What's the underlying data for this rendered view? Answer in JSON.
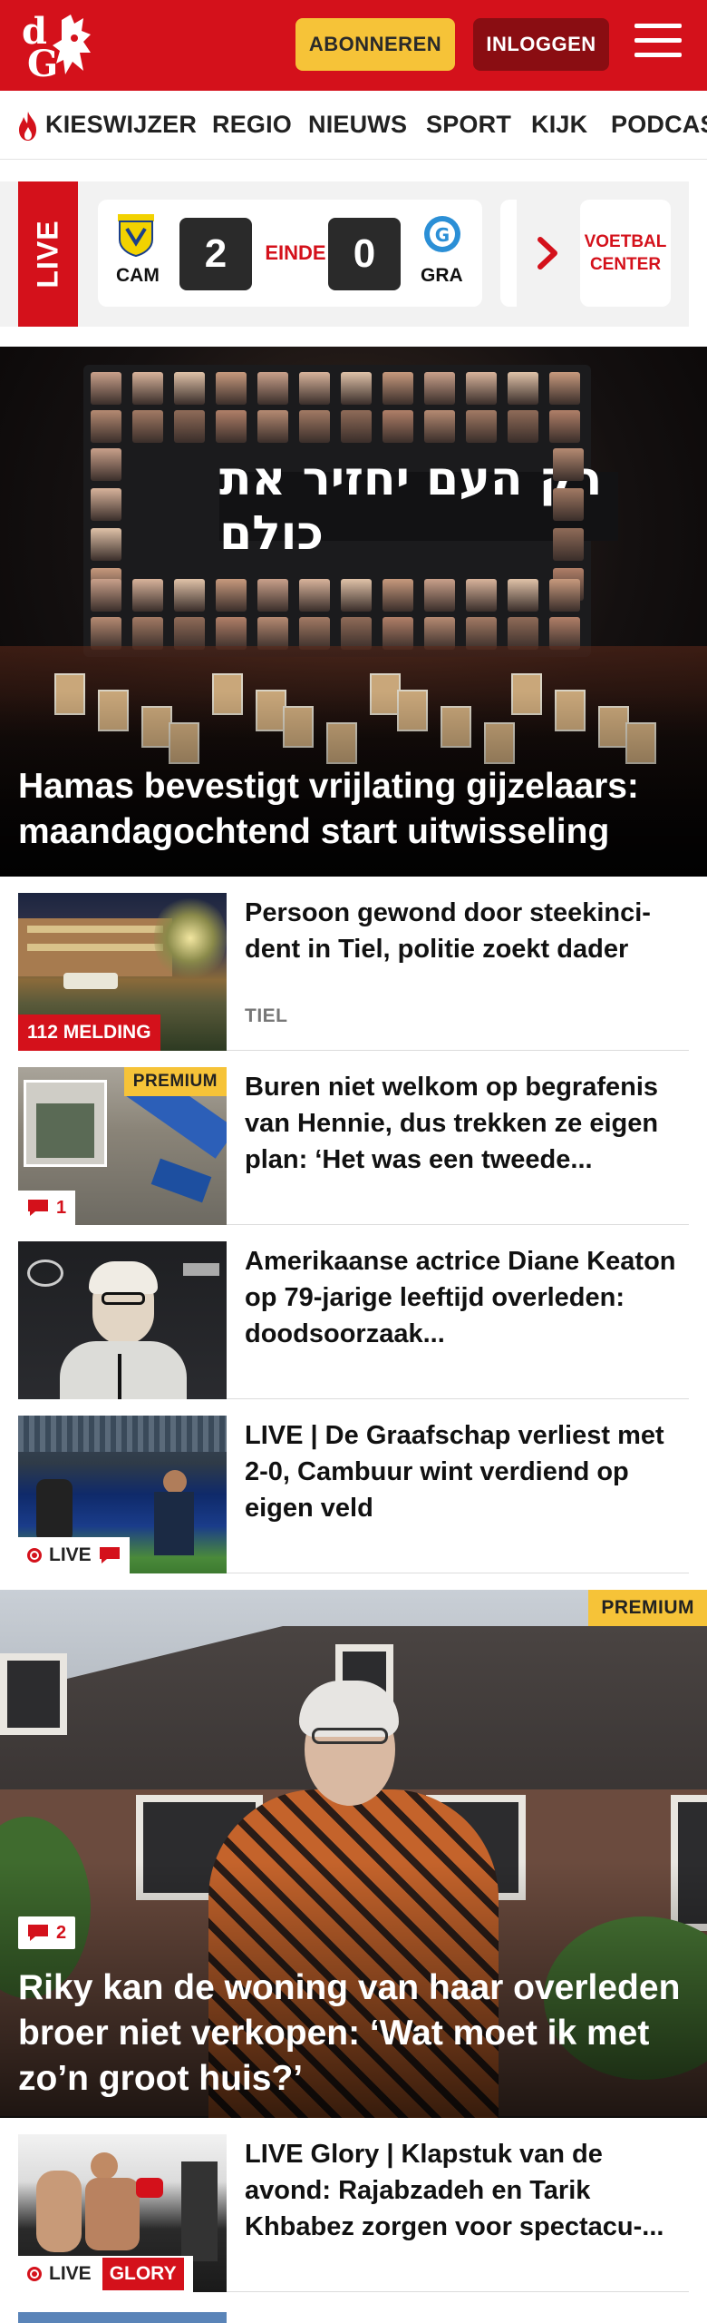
{
  "header": {
    "logo_text": "dG",
    "subscribe_label": "ABONNEREN",
    "login_label": "INLOGGEN",
    "colors": {
      "brand_red": "#d4111b",
      "subscribe_yellow": "#f6c338",
      "login_dark": "#8a0d12"
    }
  },
  "nav": {
    "items": [
      "KIESWIJZER",
      "REGIO",
      "NIEUWS",
      "SPORT",
      "KIJK",
      "PODCAS"
    ]
  },
  "live_score": {
    "tab_label": "LIVE",
    "home": {
      "abbr": "CAM"
    },
    "away": {
      "abbr": "GRA"
    },
    "home_score": "2",
    "away_score": "0",
    "status": "EINDE",
    "voetbal_center": "VOETBAL CENTER"
  },
  "hero": {
    "title": "Hamas bevestigt vrijlating gijzelaars: maandagochtend start uitwisseling",
    "banner_text": "רק העם יחזיר את כולם"
  },
  "articles": [
    {
      "title": "Persoon gewond door steekinci- dent in Tiel, politie zoekt dader",
      "tag": "TIEL",
      "badge": "112 MELDING"
    },
    {
      "title": "Buren niet welkom op begrafenis van Hennie, dus trekken ze eigen plan: ‘Het was een tweede...",
      "premium": "PREMIUM",
      "comments": "1"
    },
    {
      "title": "Amerikaanse actrice Diane Keaton op 79-jarige leeftijd overleden: doodsoorzaak..."
    },
    {
      "title": "LIVE | De Graafschap verliest met 2-0, Cambuur wint verdiend op eigen veld",
      "live_label": "LIVE"
    }
  ],
  "feature": {
    "premium": "PREMIUM",
    "comments": "2",
    "title": "Riky kan de woning van haar overleden broer niet verkopen: ‘Wat moet ik met zo’n groot huis?’"
  },
  "article_after": {
    "title": "LIVE Glory | Klapstuk van de avond: Rajabzadeh en Tarik Khbabez zorgen voor spectacu-...",
    "live_label": "LIVE",
    "glory_label": "GLORY"
  }
}
